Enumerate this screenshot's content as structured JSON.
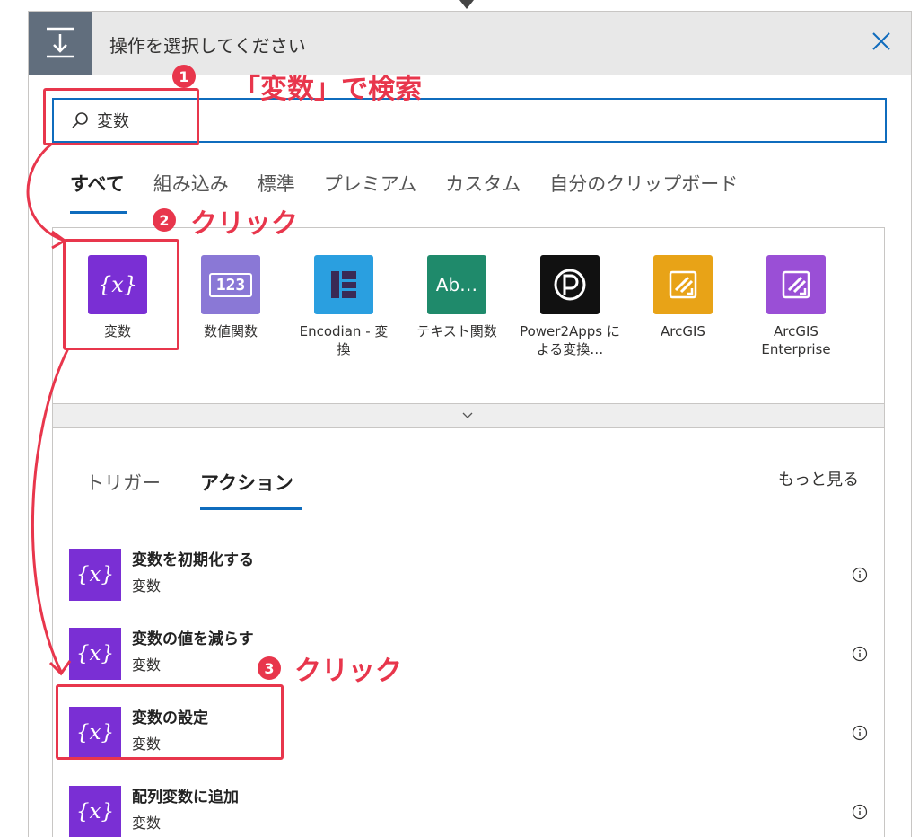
{
  "header": {
    "title": "操作を選択してください",
    "icon": "trigger-action-icon",
    "close_icon": "close-icon"
  },
  "search": {
    "value": "変数",
    "icon": "search-icon"
  },
  "tabs": [
    {
      "label": "すべて",
      "active": true
    },
    {
      "label": "組み込み",
      "active": false
    },
    {
      "label": "標準",
      "active": false
    },
    {
      "label": "プレミアム",
      "active": false
    },
    {
      "label": "カスタム",
      "active": false
    },
    {
      "label": "自分のクリップボード",
      "active": false
    }
  ],
  "connectors": [
    {
      "label": "変数",
      "icon_text": "{x}",
      "color": "#7a2fd4"
    },
    {
      "label": "数値関数",
      "icon_text": "123",
      "color": "#8a78d6"
    },
    {
      "label": "Encodian - 変換",
      "icon_text": "encodian-icon",
      "color": "#2a9fe0"
    },
    {
      "label": "テキスト関数",
      "icon_text": "Ab…",
      "color": "#1f8a6b"
    },
    {
      "label": "Power2Apps による変換…",
      "icon_text": "power2apps-icon",
      "color": "#111111"
    },
    {
      "label": "ArcGIS",
      "icon_text": "arcgis-icon",
      "color": "#e8a317"
    },
    {
      "label": "ArcGIS Enterprise",
      "icon_text": "arcgis-enterprise-icon",
      "color": "#9a4fd6"
    }
  ],
  "sub_tabs": [
    {
      "label": "トリガー",
      "active": false
    },
    {
      "label": "アクション",
      "active": true
    }
  ],
  "more_link": "もっと見る",
  "actions": [
    {
      "title": "変数を初期化する",
      "connector": "変数",
      "icon_text": "{x}"
    },
    {
      "title": "変数の値を減らす",
      "connector": "変数",
      "icon_text": "{x}"
    },
    {
      "title": "変数の設定",
      "connector": "変数",
      "icon_text": "{x}"
    },
    {
      "title": "配列変数に追加",
      "connector": "変数",
      "icon_text": "{x}"
    }
  ],
  "annotations": [
    {
      "number": "1",
      "text": "「変数」で検索"
    },
    {
      "number": "2",
      "text": "クリック"
    },
    {
      "number": "3",
      "text": "クリック"
    }
  ],
  "colors": {
    "accent": "#0f6cbd",
    "annotation": "#e8364c",
    "variable_purple": "#7a2fd4",
    "header_bg": "#e8e8e8"
  }
}
